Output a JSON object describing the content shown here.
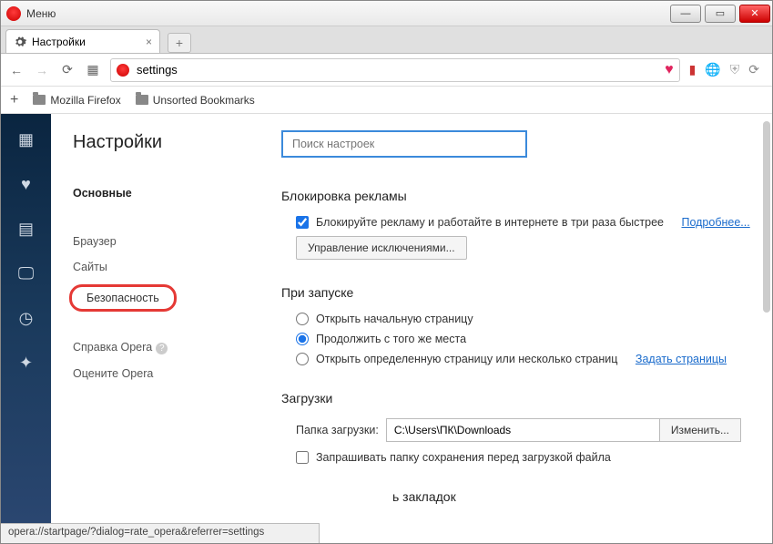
{
  "titlebar": {
    "menu": "Меню"
  },
  "tab": {
    "title": "Настройки"
  },
  "address": {
    "value": "settings"
  },
  "bookmarks": {
    "f1": "Mozilla Firefox",
    "f2": "Unsorted Bookmarks"
  },
  "sidebar": {
    "title": "Настройки",
    "items": [
      "Основные",
      "Браузер",
      "Сайты",
      "Безопасность",
      "Справка Opera",
      "Оцените Opera"
    ]
  },
  "search": {
    "placeholder": "Поиск настроек"
  },
  "sections": {
    "adblock": {
      "title": "Блокировка рекламы",
      "checkbox": "Блокируйте рекламу и работайте в интернете в три раза быстрее",
      "more": "Подробнее...",
      "manage": "Управление исключениями..."
    },
    "startup": {
      "title": "При запуске",
      "opt1": "Открыть начальную страницу",
      "opt2": "Продолжить с того же места",
      "opt3": "Открыть определенную страницу или несколько страниц",
      "setpages": "Задать страницы"
    },
    "downloads": {
      "title": "Загрузки",
      "label": "Папка загрузки:",
      "path": "C:\\Users\\ПК\\Downloads",
      "change": "Изменить...",
      "ask": "Запрашивать папку сохранения перед загрузкой файла"
    },
    "bookmarks": {
      "title_partial": "ь закладок"
    }
  },
  "status": "opera://startpage/?dialog=rate_opera&referrer=settings"
}
